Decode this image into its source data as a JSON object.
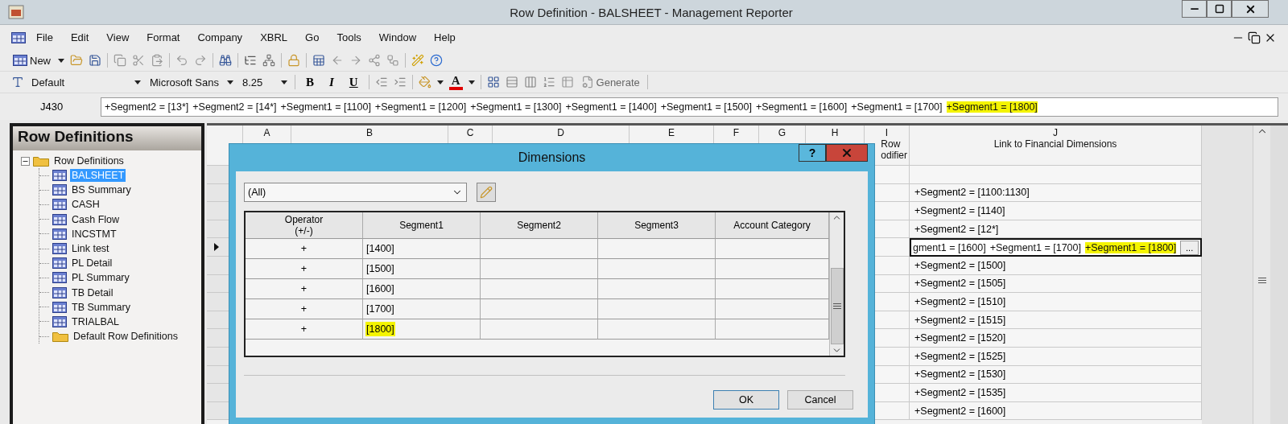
{
  "window": {
    "title": "Row Definition - BALSHEET - Management Reporter"
  },
  "menu": [
    "File",
    "Edit",
    "View",
    "Format",
    "Company",
    "XBRL",
    "Go",
    "Tools",
    "Window",
    "Help"
  ],
  "toolbar": {
    "new_label": "New"
  },
  "format_bar": {
    "style": "Default",
    "font": "Microsoft Sans",
    "size": "8.25",
    "bold": "B",
    "italic": "I",
    "underline": "U",
    "font_color": "A",
    "generate": "Generate"
  },
  "formula_bar": {
    "cell": "J430",
    "terms": [
      {
        "text": "+Segment2 = [13*]",
        "highlighted": false
      },
      {
        "text": "+Segment2 = [14*]",
        "highlighted": false
      },
      {
        "text": "+Segment1 = [1100]",
        "highlighted": false
      },
      {
        "text": "+Segment1 = [1200]",
        "highlighted": false
      },
      {
        "text": "+Segment1 = [1300]",
        "highlighted": false
      },
      {
        "text": "+Segment1 = [1400]",
        "highlighted": false
      },
      {
        "text": "+Segment1 = [1500]",
        "highlighted": false
      },
      {
        "text": "+Segment1 = [1600]",
        "highlighted": false
      },
      {
        "text": "+Segment1 = [1700]",
        "highlighted": false
      },
      {
        "text": "+Segment1 = [1800]",
        "highlighted": true
      }
    ]
  },
  "tree": {
    "title": "Row Definitions",
    "items": [
      {
        "label": "Row Definitions",
        "kind": "folder",
        "expanded": true,
        "children": [
          {
            "label": "BALSHEET",
            "kind": "definition",
            "selected": true
          },
          {
            "label": "BS Summary",
            "kind": "definition",
            "selected": false
          },
          {
            "label": "CASH",
            "kind": "definition",
            "selected": false
          },
          {
            "label": "Cash Flow",
            "kind": "definition",
            "selected": false
          },
          {
            "label": "INCSTMT",
            "kind": "definition",
            "selected": false
          },
          {
            "label": "Link test",
            "kind": "definition",
            "selected": false
          },
          {
            "label": "PL Detail",
            "kind": "definition",
            "selected": false
          },
          {
            "label": "PL Summary",
            "kind": "definition",
            "selected": false
          },
          {
            "label": "TB Detail",
            "kind": "definition",
            "selected": false
          },
          {
            "label": "TB Summary",
            "kind": "definition",
            "selected": false
          },
          {
            "label": "TRIALBAL",
            "kind": "definition",
            "selected": false
          },
          {
            "label": "Default Row Definitions",
            "kind": "folder",
            "selected": false
          }
        ]
      }
    ]
  },
  "grid": {
    "columns": [
      {
        "letter": "A"
      },
      {
        "letter": "B"
      },
      {
        "letter": "C"
      },
      {
        "letter": "D"
      },
      {
        "letter": "E"
      },
      {
        "letter": "F"
      },
      {
        "letter": "G"
      },
      {
        "letter": "H"
      },
      {
        "letter": "I",
        "label": "Row\nodifier"
      },
      {
        "letter": "J",
        "label": "Link to Financial Dimensions"
      }
    ],
    "rows": [
      {
        "current": false
      },
      {
        "current": false,
        "link": "+Segment2 = [1100:1130]"
      },
      {
        "current": false,
        "link": "+Segment2 = [1140]"
      },
      {
        "current": false,
        "link": "+Segment2 = [12*]"
      },
      {
        "current": true,
        "link_terms": [
          {
            "text": "gment1 = [1600]",
            "highlighted": false
          },
          {
            "text": "+Segment1 = [1700]",
            "highlighted": false
          },
          {
            "text": "+Segment1 = [1800]",
            "highlighted": true
          }
        ],
        "browse": "..."
      },
      {
        "current": false,
        "link": "+Segment2 = [1500]"
      },
      {
        "current": false,
        "link": "+Segment2 = [1505]"
      },
      {
        "current": false,
        "link": "+Segment2 = [1510]"
      },
      {
        "current": false,
        "link": "+Segment2 = [1515]"
      },
      {
        "current": false,
        "link": "+Segment2 = [1520]"
      },
      {
        "current": false,
        "link": "+Segment2 = [1525]"
      },
      {
        "current": false,
        "link": "+Segment2 = [1530]"
      },
      {
        "current": false,
        "link": "+Segment2 = [1535]"
      },
      {
        "current": false,
        "link": "+Segment2 = [1600]"
      }
    ]
  },
  "dialog": {
    "title": "Dimensions",
    "help": "?",
    "filter": "(All)",
    "columns": [
      "Operator\n(+/-)",
      "Segment1",
      "Segment2",
      "Segment3",
      "Account Category"
    ],
    "rows": [
      {
        "operator": "+",
        "segment1": {
          "text": "[1400]",
          "highlighted": false
        }
      },
      {
        "operator": "+",
        "segment1": {
          "text": "[1500]",
          "highlighted": false
        }
      },
      {
        "operator": "+",
        "segment1": {
          "text": "[1600]",
          "highlighted": false
        }
      },
      {
        "operator": "+",
        "segment1": {
          "text": "[1700]",
          "highlighted": false
        }
      },
      {
        "operator": "+",
        "segment1": {
          "text": "[1800]",
          "highlighted": true
        }
      }
    ],
    "buttons": [
      "OK",
      "Cancel"
    ]
  }
}
